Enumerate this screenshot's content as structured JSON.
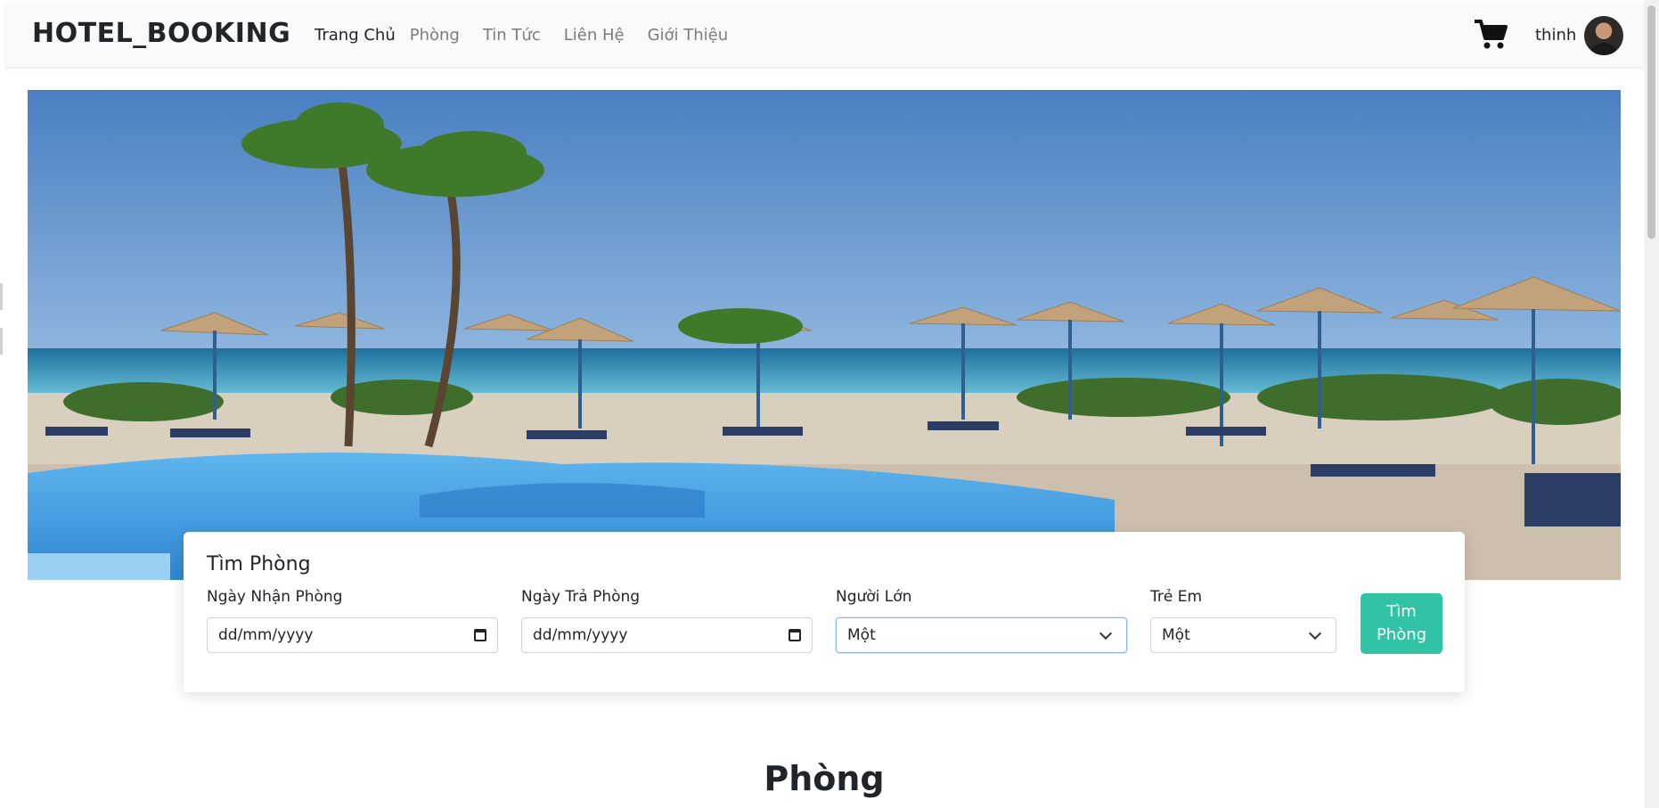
{
  "navbar": {
    "brand": "HOTEL_BOOKING",
    "links": [
      "Trang Chủ",
      "Phòng",
      "Tin Tức",
      "Liên Hệ",
      "Giới Thiệu"
    ],
    "active_index": 0,
    "username": "thinh",
    "cart_icon": "shopping-cart-icon"
  },
  "hero": {
    "alt": "resort pool and beach with thatched umbrellas"
  },
  "search": {
    "title": "Tìm Phòng",
    "checkin_label": "Ngày Nhận Phòng",
    "checkin_placeholder": "dd/mm/yyyy",
    "checkout_label": "Ngày Trả Phòng",
    "checkout_placeholder": "dd/mm/yyyy",
    "adults_label": "Người Lớn",
    "adults_value": "Một",
    "children_label": "Trẻ Em",
    "children_value": "Một",
    "button_line1": "Tìm",
    "button_line2": "Phòng"
  },
  "rooms_section": {
    "title": "Phòng"
  },
  "colors": {
    "accent": "#31c3a6",
    "navbar_bg": "#f8f9fa",
    "sky": "#5b8ec8",
    "pool": "#4fa8e6"
  }
}
